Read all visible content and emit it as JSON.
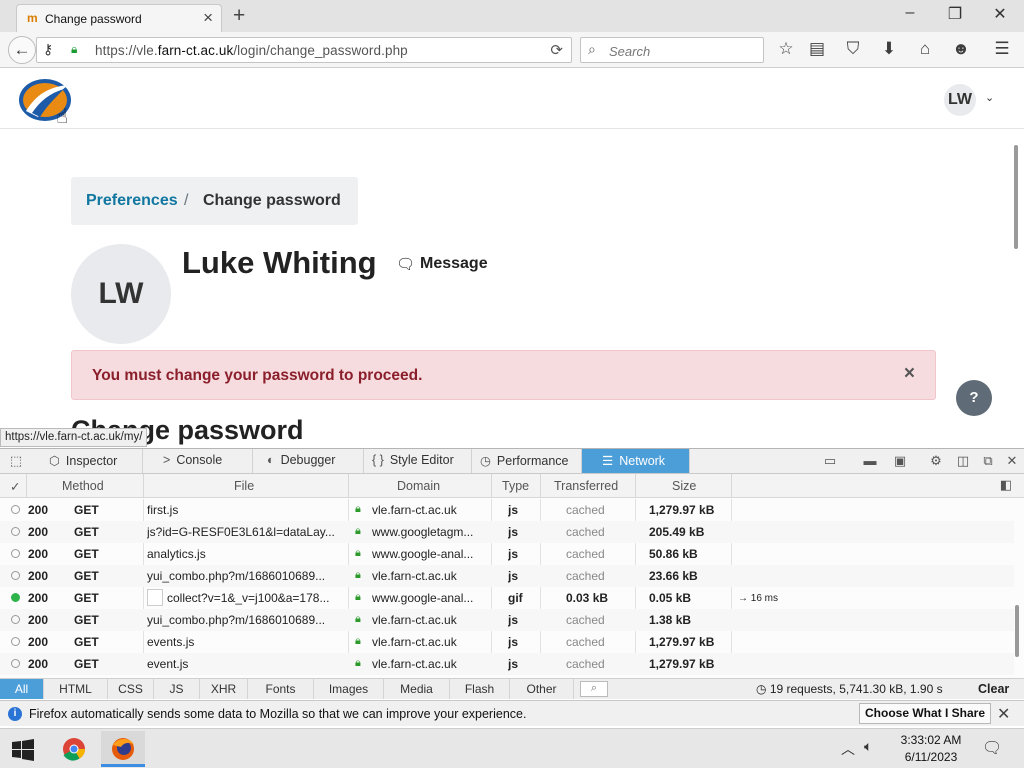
{
  "browser": {
    "tab_title": "Change password",
    "tab_favicon": "m",
    "url_prefix": "https://vle.",
    "url_domain": "farn-ct.ac.uk",
    "url_path": "/login/change_password.php",
    "search_placeholder": "Search",
    "status_url": "https://vle.farn-ct.ac.uk/my/"
  },
  "page": {
    "user_initials": "LW",
    "breadcrumb": {
      "parent": "Preferences",
      "separator": "/",
      "current": "Change password"
    },
    "profile": {
      "initials": "LW",
      "name": "Luke Whiting",
      "message_label": "Message"
    },
    "alert": {
      "text": "You must change your password to proceed.",
      "close": "×",
      "color": "#8a1f2b"
    },
    "help_label": "?",
    "heading": "Change password"
  },
  "devtools": {
    "tabs": [
      {
        "icon": "⬡",
        "label": "Inspector"
      },
      {
        "icon": ">",
        "label": "Console"
      },
      {
        "icon": "◐",
        "label": "Debugger"
      },
      {
        "icon": "{ }",
        "label": "Style Editor"
      },
      {
        "icon": "◷",
        "label": "Performance"
      },
      {
        "icon": "☰",
        "label": "Network"
      }
    ],
    "active_tab": "Network",
    "accent": "#4c9ed9",
    "columns": [
      "✓",
      "Method",
      "File",
      "Domain",
      "Type",
      "Transferred",
      "Size"
    ],
    "requests": [
      {
        "status": "200",
        "method": "GET",
        "file": "first.js",
        "domain": "vle.farn-ct.ac.uk",
        "type": "js",
        "transferred": "cached",
        "size": "1,279.97 kB",
        "timing": "",
        "live": false
      },
      {
        "status": "200",
        "method": "GET",
        "file": "js?id=G-RESF0E3L61&l=dataLay...",
        "domain": "www.googletagm...",
        "type": "js",
        "transferred": "cached",
        "size": "205.49 kB",
        "timing": "",
        "live": false
      },
      {
        "status": "200",
        "method": "GET",
        "file": "analytics.js",
        "domain": "www.google-anal...",
        "type": "js",
        "transferred": "cached",
        "size": "50.86 kB",
        "timing": "",
        "live": false
      },
      {
        "status": "200",
        "method": "GET",
        "file": "yui_combo.php?m/1686010689...",
        "domain": "vle.farn-ct.ac.uk",
        "type": "js",
        "transferred": "cached",
        "size": "23.66 kB",
        "timing": "",
        "live": false
      },
      {
        "status": "200",
        "method": "GET",
        "file": "collect?v=1&_v=j100&a=178...",
        "domain": "www.google-anal...",
        "type": "gif",
        "transferred": "0.03 kB",
        "size": "0.05 kB",
        "timing": "→ 16 ms",
        "live": true
      },
      {
        "status": "200",
        "method": "GET",
        "file": "yui_combo.php?m/1686010689...",
        "domain": "vle.farn-ct.ac.uk",
        "type": "js",
        "transferred": "cached",
        "size": "1.38 kB",
        "timing": "",
        "live": false
      },
      {
        "status": "200",
        "method": "GET",
        "file": "events.js",
        "domain": "vle.farn-ct.ac.uk",
        "type": "js",
        "transferred": "cached",
        "size": "1,279.97 kB",
        "timing": "",
        "live": false
      },
      {
        "status": "200",
        "method": "GET",
        "file": "event.js",
        "domain": "vle.farn-ct.ac.uk",
        "type": "js",
        "transferred": "cached",
        "size": "1,279.97 kB",
        "timing": "",
        "live": false
      }
    ],
    "filters": [
      "All",
      "HTML",
      "CSS",
      "JS",
      "XHR",
      "Fonts",
      "Images",
      "Media",
      "Flash",
      "Other"
    ],
    "active_filter": "All",
    "summary": "19 requests, 5,741.30 kB, 1.90 s",
    "clear_label": "Clear"
  },
  "notification": {
    "text": "Firefox automatically sends some data to Mozilla so that we can improve your experience.",
    "button": "Choose What I Share"
  },
  "taskbar": {
    "time": "3:33:02 AM",
    "date": "6/11/2023"
  }
}
